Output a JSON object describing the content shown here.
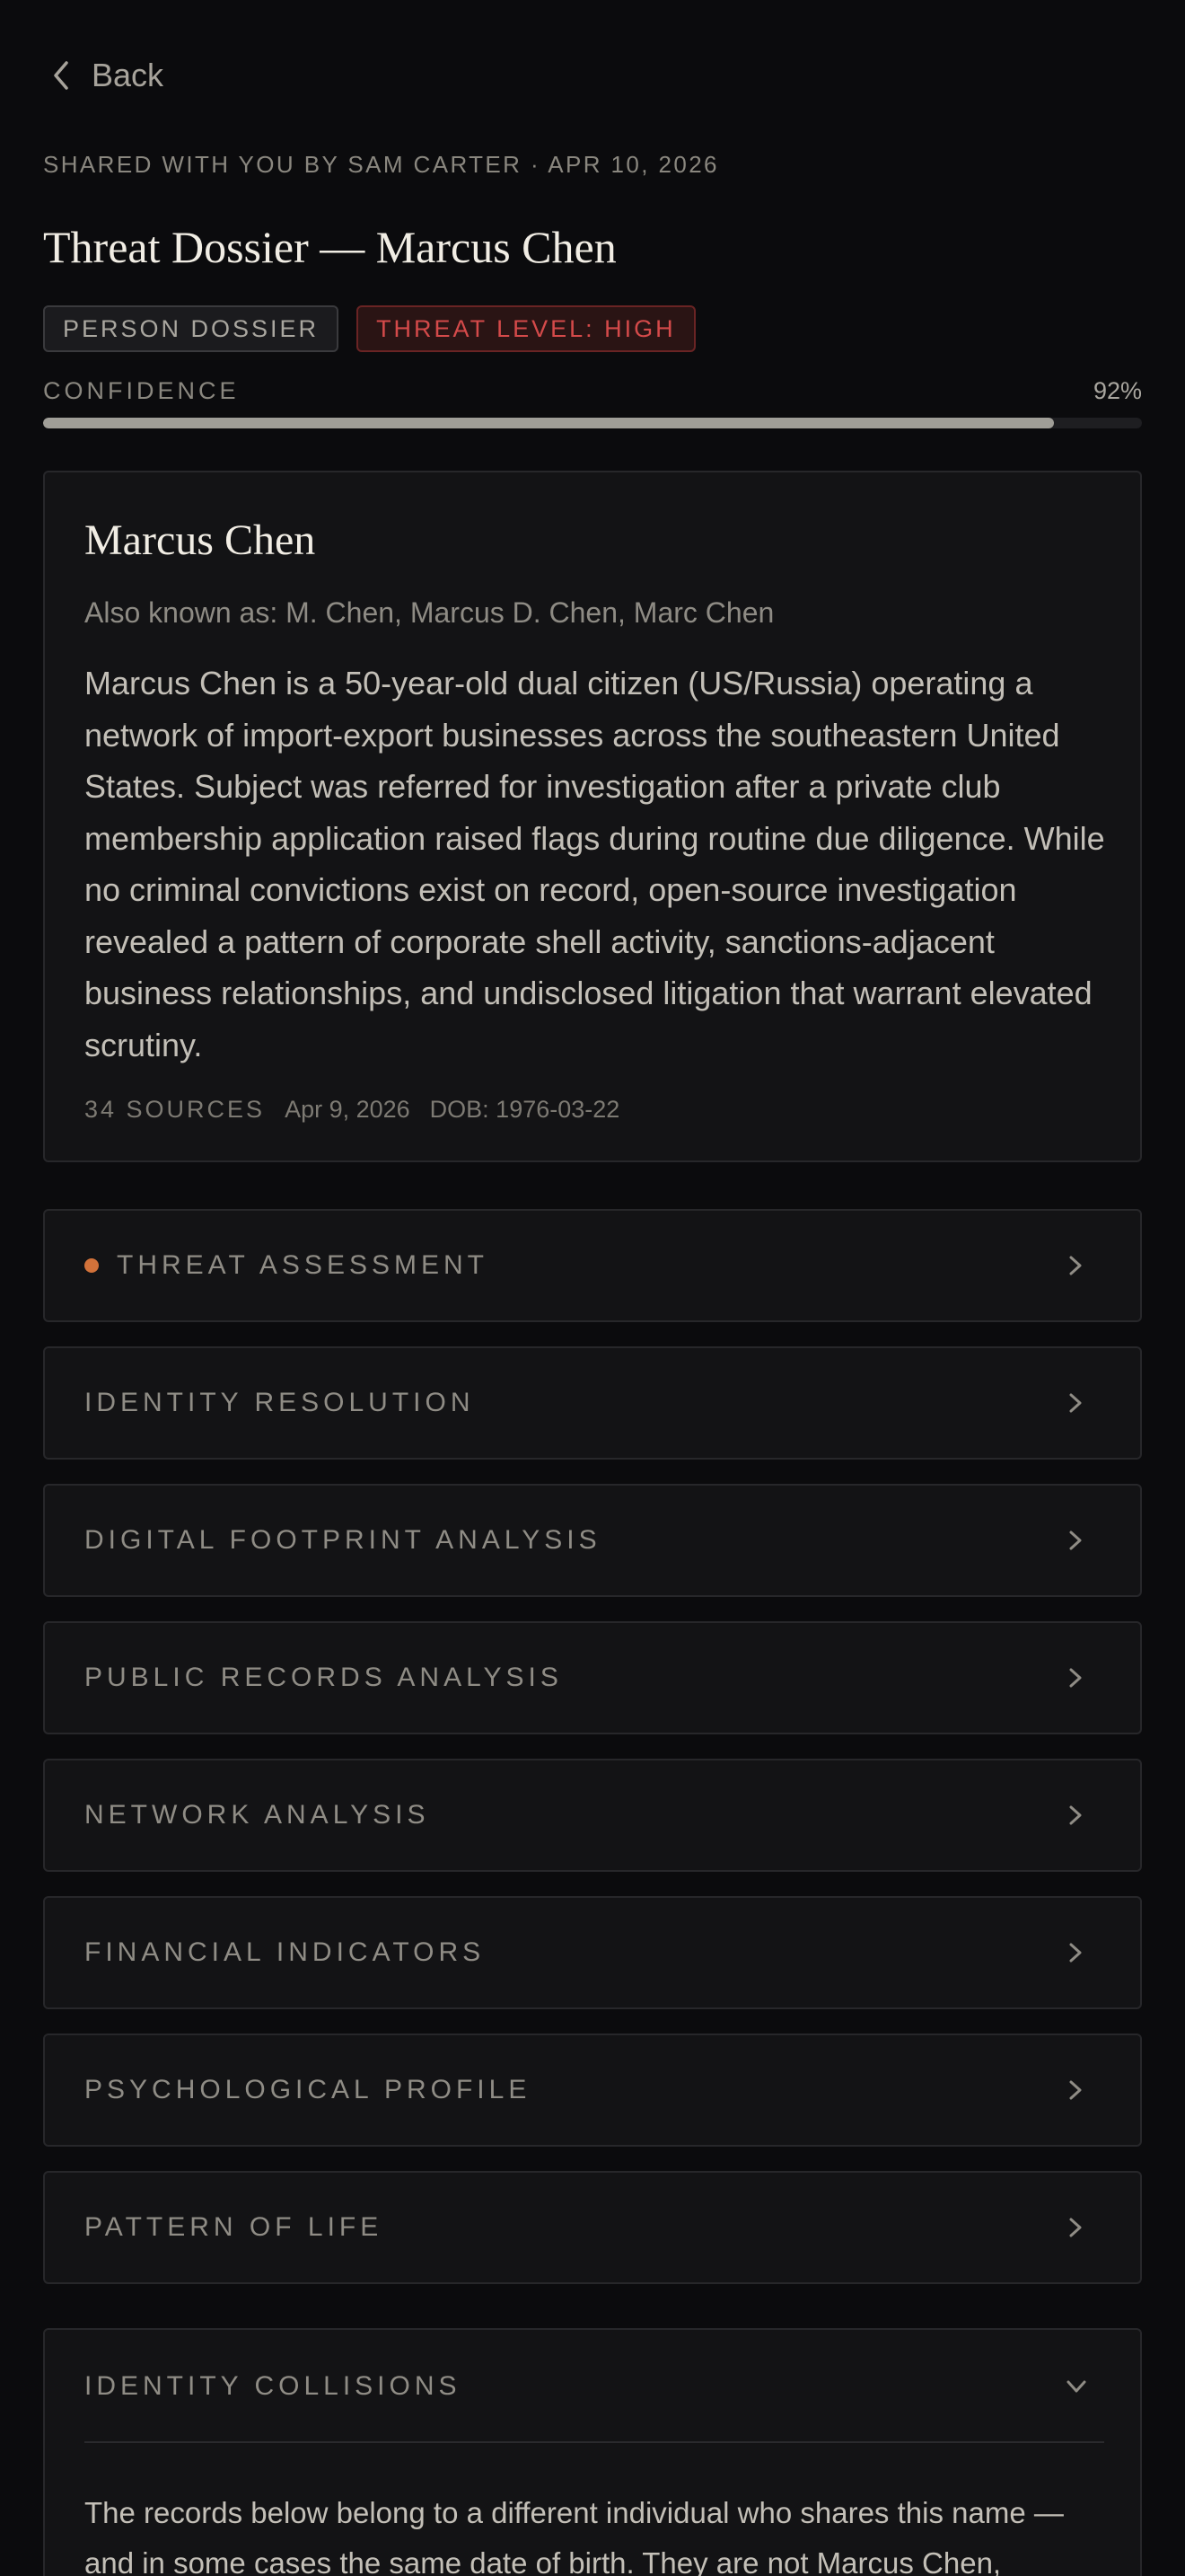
{
  "nav": {
    "back_label": "Back"
  },
  "header": {
    "shared_line": "SHARED WITH YOU BY SAM CARTER · APR 10, 2026",
    "title": "Threat Dossier — Marcus Chen",
    "tags": [
      "PERSON DOSSIER",
      "THREAT LEVEL: HIGH"
    ]
  },
  "confidence": {
    "label": "CONFIDENCE",
    "value_text": "92%",
    "value": 0.92
  },
  "profile": {
    "name": "Marcus Chen",
    "aka": "Also known as: M. Chen, Marcus D. Chen, Marc Chen",
    "summary": "Marcus Chen is a 50-year-old dual citizen (US/Russia) operating a network of import-export businesses across the southeastern United States. Subject was referred for investigation after a private club membership application raised flags during routine due diligence. While no criminal convictions exist on record, open-source investigation revealed a pattern of corporate shell activity, sanctions-adjacent business relationships, and undisclosed litigation that warrant elevated scrutiny.",
    "sources": "34 SOURCES",
    "date": "Apr 9, 2026",
    "dob": "DOB: 1976-03-22"
  },
  "sections": [
    {
      "label": "THREAT ASSESSMENT",
      "flagged": true
    },
    {
      "label": "IDENTITY RESOLUTION",
      "flagged": false
    },
    {
      "label": "DIGITAL FOOTPRINT ANALYSIS",
      "flagged": false
    },
    {
      "label": "PUBLIC RECORDS ANALYSIS",
      "flagged": false
    },
    {
      "label": "NETWORK ANALYSIS",
      "flagged": false
    },
    {
      "label": "FINANCIAL INDICATORS",
      "flagged": false
    },
    {
      "label": "PSYCHOLOGICAL PROFILE",
      "flagged": false
    },
    {
      "label": "PATTERN OF LIFE",
      "flagged": false
    }
  ],
  "collisions": {
    "label": "IDENTITY COLLISIONS",
    "text": "The records below belong to a different individual who shares this name — and in some cases the same date of birth. They are not Marcus Chen,"
  },
  "colors": {
    "background": "#0b0b0d",
    "card": "#131315",
    "threat_red": "#d44a4a",
    "flag_orange": "#d2723a"
  }
}
